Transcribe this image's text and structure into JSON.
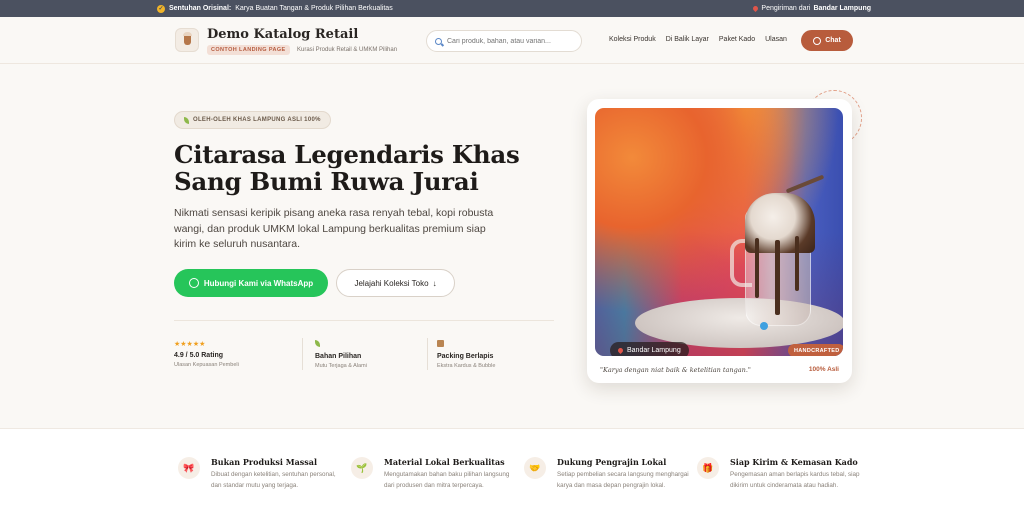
{
  "topbar": {
    "left_label": "Sentuhan Orisinal:",
    "left_text": "Karya Buatan Tangan & Produk Pilihan Berkualitas",
    "right_text": "Pengiriman dari",
    "right_location": "Bandar Lampung"
  },
  "header": {
    "brand": "Demo Katalog Retail",
    "badge": "CONTOH LANDING PAGE",
    "subtitle": "Kurasi Produk Retail & UMKM Pilihan",
    "search_placeholder": "Cari produk, bahan, atau varian...",
    "nav": [
      "Koleksi Produk",
      "Di Balik Layar",
      "Paket Kado",
      "Ulasan"
    ],
    "chat_label": "Chat"
  },
  "hero": {
    "tag": "OLEH-OLEH KHAS LAMPUNG ASLI 100%",
    "title": "Citarasa Legendaris Khas Sang Bumi Ruwa Jurai",
    "lead": "Nikmati sensasi keripik pisang aneka rasa renyah tebal, kopi robusta wangi, dan produk UMKM lokal Lampung berkualitas premium siap kirim ke seluruh nusantara.",
    "primary_button": "Hubungi Kami via WhatsApp",
    "secondary_button": "Jelajahi Koleksi Toko",
    "stats": [
      {
        "icon": "★★★★★",
        "title": "4.9 / 5.0 Rating",
        "sub": "Ulasan Kepuasan Pembeli"
      },
      {
        "icon": "leaf-icon",
        "title": "Bahan Pilihan",
        "sub": "Mutu Terjaga & Alami"
      },
      {
        "icon": "box-icon",
        "title": "Packing Berlapis",
        "sub": "Ekstra Kardus & Bubble"
      }
    ]
  },
  "card": {
    "location": "Bandar Lampung",
    "badge": "HANDCRAFTED",
    "quote": "\"Karya dengan niat baik & ketelitian tangan.\"",
    "note": "100% Asli"
  },
  "features": [
    {
      "icon": "ribbon-icon",
      "title": "Bukan Produksi Massal",
      "desc": "Dibuat dengan ketelitian, sentuhan personal, dan standar mutu yang terjaga."
    },
    {
      "icon": "sprout-icon",
      "title": "Material Lokal Berkualitas",
      "desc": "Mengutamakan bahan baku pilihan langsung dari produsen dan mitra terpercaya."
    },
    {
      "icon": "handshake-icon",
      "title": "Dukung Pengrajin Lokal",
      "desc": "Setiap pembelian secara langsung menghargai karya dan masa depan pengrajin lokal."
    },
    {
      "icon": "gift-icon",
      "title": "Siap Kirim & Kemasan Kado",
      "desc": "Pengemasan aman berlapis kardus tebal, siap dikirim untuk cinderamata atau hadiah."
    }
  ],
  "colors": {
    "accent": "#b85c3c",
    "whatsapp": "#26c55a",
    "topbar": "#4b5160"
  }
}
